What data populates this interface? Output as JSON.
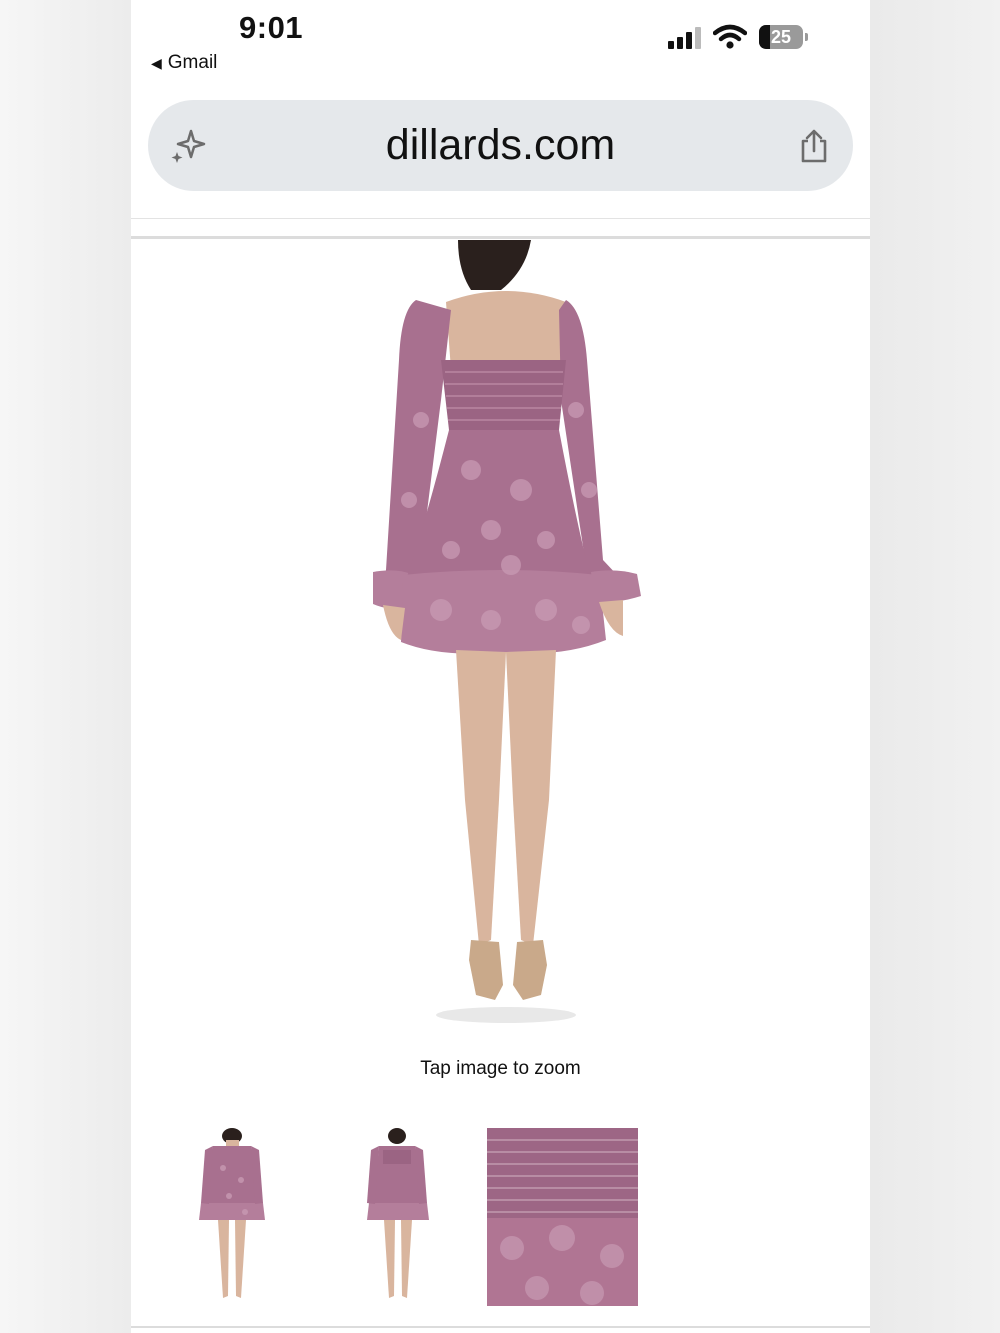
{
  "status_bar": {
    "time": "9:01",
    "back_app": "Gmail",
    "battery": "25"
  },
  "address_bar": {
    "url": "dillards.com"
  },
  "product": {
    "zoom_hint": "Tap image to zoom",
    "dress_color": "#a8708f"
  },
  "icons": {
    "back": "back-arrow-icon",
    "signal": "cellular-signal-icon",
    "wifi": "wifi-icon",
    "battery": "battery-icon",
    "sparkle": "sparkle-icon",
    "share": "share-icon"
  }
}
